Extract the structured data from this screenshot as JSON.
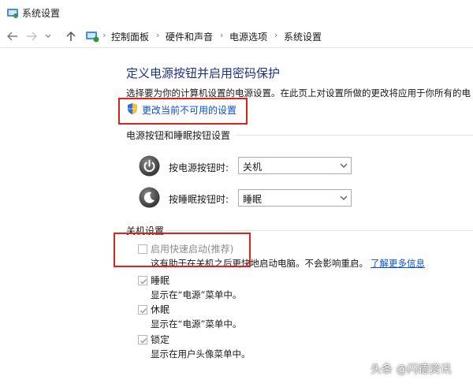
{
  "window": {
    "title": "系统设置"
  },
  "nav": {
    "breadcrumb": [
      "控制面板",
      "硬件和声音",
      "电源选项",
      "系统设置"
    ]
  },
  "main": {
    "title": "定义电源按钮并启用密码保护",
    "description": "选择要为你的计算机设置的电源设置。在此页上对设置所做的更改将应用于你所有的电",
    "change_link": "更改当前不可用的设置",
    "buttons_section": {
      "heading": "电源按钮和睡眠按钮设置",
      "power_button": {
        "label": "按电源按钮时:",
        "value": "关机"
      },
      "sleep_button": {
        "label": "按睡眠按钮时:",
        "value": "睡眠"
      }
    },
    "shutdown_section": {
      "heading": "关机设置",
      "options": [
        {
          "label": "启用快速启动(推荐)",
          "desc": "这有助于在关机之后更快地启动电脑。不会影响重启。",
          "link": "了解更多信息",
          "checked": false
        },
        {
          "label": "睡眠",
          "desc": "显示在“电源”菜单中。",
          "checked": true
        },
        {
          "label": "休眠",
          "desc": "显示在“电源”菜单中。",
          "checked": true
        },
        {
          "label": "锁定",
          "desc": "显示在用户头像菜单中。",
          "checked": true
        }
      ]
    }
  },
  "watermark": "头条 @闪德资讯",
  "colors": {
    "title": "#1e3287",
    "link": "#0a4fd1",
    "highlight_box": "#e02020"
  }
}
